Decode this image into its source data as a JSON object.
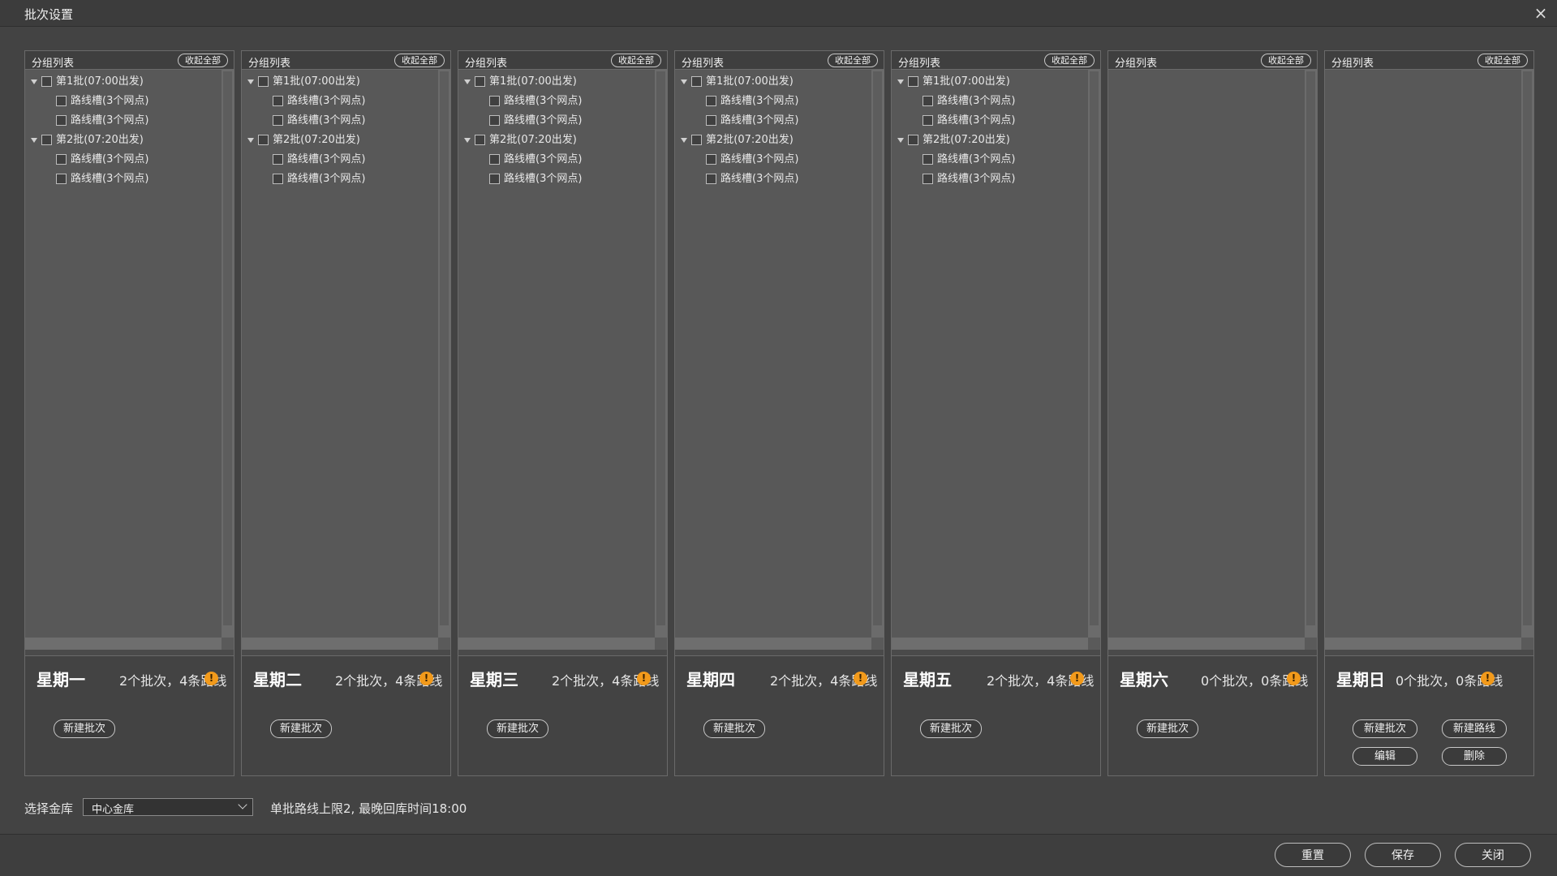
{
  "window": {
    "title": "批次设置",
    "close_glyph": "×"
  },
  "column_header": {
    "label": "分组列表",
    "collapse_label": "收起全部"
  },
  "columns": [
    {
      "day": "星期一",
      "summary": "2个批次，4条路线",
      "show_collapse": true,
      "groups": [
        {
          "label": "第1批(07:00出发)",
          "routes": [
            "路线槽(3个网点)",
            "路线槽(3个网点)"
          ]
        },
        {
          "label": "第2批(07:20出发)",
          "routes": [
            "路线槽(3个网点)",
            "路线槽(3个网点)"
          ]
        }
      ],
      "buttons": [
        "新建批次"
      ]
    },
    {
      "day": "星期二",
      "summary": "2个批次，4条路线",
      "show_collapse": true,
      "groups": [
        {
          "label": "第1批(07:00出发)",
          "routes": [
            "路线槽(3个网点)",
            "路线槽(3个网点)"
          ]
        },
        {
          "label": "第2批(07:20出发)",
          "routes": [
            "路线槽(3个网点)",
            "路线槽(3个网点)"
          ]
        }
      ],
      "buttons": [
        "新建批次"
      ]
    },
    {
      "day": "星期三",
      "summary": "2个批次，4条路线",
      "show_collapse": true,
      "groups": [
        {
          "label": "第1批(07:00出发)",
          "routes": [
            "路线槽(3个网点)",
            "路线槽(3个网点)"
          ]
        },
        {
          "label": "第2批(07:20出发)",
          "routes": [
            "路线槽(3个网点)",
            "路线槽(3个网点)"
          ]
        }
      ],
      "buttons": [
        "新建批次"
      ]
    },
    {
      "day": "星期四",
      "summary": "2个批次，4条路线",
      "show_collapse": true,
      "groups": [
        {
          "label": "第1批(07:00出发)",
          "routes": [
            "路线槽(3个网点)",
            "路线槽(3个网点)"
          ]
        },
        {
          "label": "第2批(07:20出发)",
          "routes": [
            "路线槽(3个网点)",
            "路线槽(3个网点)"
          ]
        }
      ],
      "buttons": [
        "新建批次"
      ]
    },
    {
      "day": "星期五",
      "summary": "2个批次，4条路线",
      "show_collapse": true,
      "groups": [
        {
          "label": "第1批(07:00出发)",
          "routes": [
            "路线槽(3个网点)",
            "路线槽(3个网点)"
          ]
        },
        {
          "label": "第2批(07:20出发)",
          "routes": [
            "路线槽(3个网点)",
            "路线槽(3个网点)"
          ]
        }
      ],
      "buttons": [
        "新建批次"
      ]
    },
    {
      "day": "星期六",
      "summary": "0个批次，0条路线",
      "show_collapse": true,
      "groups": [],
      "buttons": [
        "新建批次"
      ]
    },
    {
      "day": "星期日",
      "summary": "0个批次，0条路线",
      "show_collapse": true,
      "groups": [],
      "buttons": [
        "新建批次",
        "新建路线",
        "编辑",
        "删除"
      ]
    }
  ],
  "warn_glyph": "!",
  "footer": {
    "vault_label": "选择金库",
    "vault_value": "中心金库",
    "note": "单批路线上限2, 最晚回库时间18:00",
    "buttons": {
      "reset": "重置",
      "save": "保存",
      "close": "关闭"
    }
  },
  "colors": {
    "warning": "#f29a1b",
    "panel": "#585858",
    "background": "#434343"
  }
}
